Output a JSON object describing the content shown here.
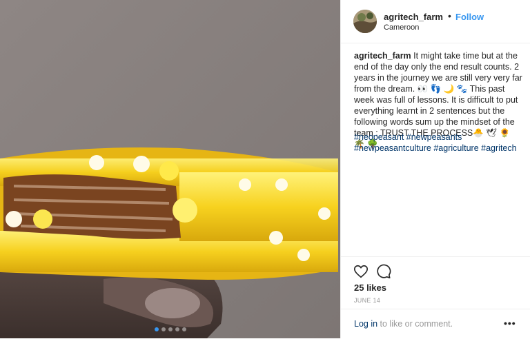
{
  "post": {
    "username": "agritech_farm",
    "separator": "•",
    "follow_label": "Follow",
    "location": "Cameroon",
    "caption_user": "agritech_farm",
    "caption_text": "It might take time but at the end of the day only the end result counts. 2 years in the journey we are still very very far from the dream. 👀 👣 🌙 🐾  This past week was full of lessons. It is difficult to put everything learnt in 2 sentences but the following words sum up the mindset of the team : TRUST THE PROCESS🐣 🕊 🌻 🌴 🌳",
    "hashtags": "#neopeasant #newpeasants #newpeasantculture #agriculture #agritech",
    "likes": "25 likes",
    "date": "JUNE 14",
    "login_link": "Log in",
    "login_rest": " to like or comment.",
    "more_label": "•••",
    "carousel": {
      "count": 5,
      "active": 1
    }
  },
  "icons": {
    "like": "heart-icon",
    "comment": "comment-icon",
    "more": "more-options-icon"
  },
  "colors": {
    "link_blue": "#3897f0",
    "hashtag": "#003569",
    "muted": "#999999"
  }
}
